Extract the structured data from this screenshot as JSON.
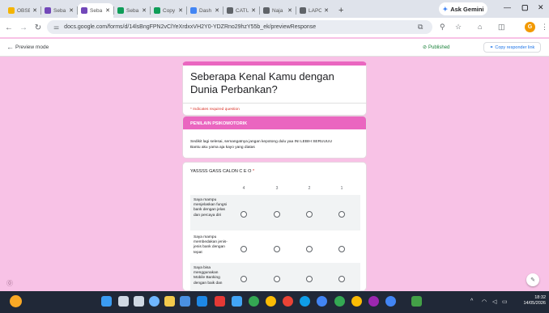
{
  "browser": {
    "tabs": [
      {
        "label": "OBSE",
        "color": "#f4b400",
        "active": false
      },
      {
        "label": "Seba",
        "color": "#7248b9",
        "active": false
      },
      {
        "label": "Seba",
        "color": "#7248b9",
        "active": true
      },
      {
        "label": "Seba",
        "color": "#0f9d58",
        "active": false
      },
      {
        "label": "Copy",
        "color": "#0f9d58",
        "active": false
      },
      {
        "label": "Dash",
        "color": "#4285f4",
        "active": false
      },
      {
        "label": "CATU",
        "color": "#5f6368",
        "active": false
      },
      {
        "label": "Naja",
        "color": "#5f6368",
        "active": false
      },
      {
        "label": "LAPO",
        "color": "#5f6368",
        "active": false
      }
    ],
    "new_tab": "+",
    "gemini_label": "Ask Gemini",
    "url": "docs.google.com/forms/d/14lsBngFPN2vClYeXrdxxVH2Y0-YDZRno29hzY55b_ek/previewResponse",
    "profile_initial": "G"
  },
  "preview": {
    "mode_label": "Preview mode",
    "published_label": "Published",
    "copy_link_label": "Copy responder link"
  },
  "form": {
    "title": "Seberapa Kenal Kamu dengan Dunia Perbankan?",
    "required_note": "* Indicates required question",
    "section_title": "PENILAIN PSIKOMOTORIK",
    "section_desc_1": "Sedikit lagi selesai, semangatnya jangan kepotong dulu yaa INI LEBIH SERUUUU",
    "section_desc_2": "Bantu aku yama aja kayo yang diatas",
    "grid": {
      "title": "YASSSS GASS CALON   C E O",
      "required_star": "*",
      "columns": [
        "4",
        "3",
        "2",
        "1"
      ],
      "rows": [
        "Saya mampu menjelaskan fungsi bank dengan jelas dan percaya diri",
        "Saya mampu membedakan jenis-jenis bank dengan tepat",
        "Saya bisa menggunakan Mobile Banking dengan baik dan"
      ]
    }
  },
  "taskbar": {
    "time": "18:32",
    "date": "14/05/2026"
  }
}
